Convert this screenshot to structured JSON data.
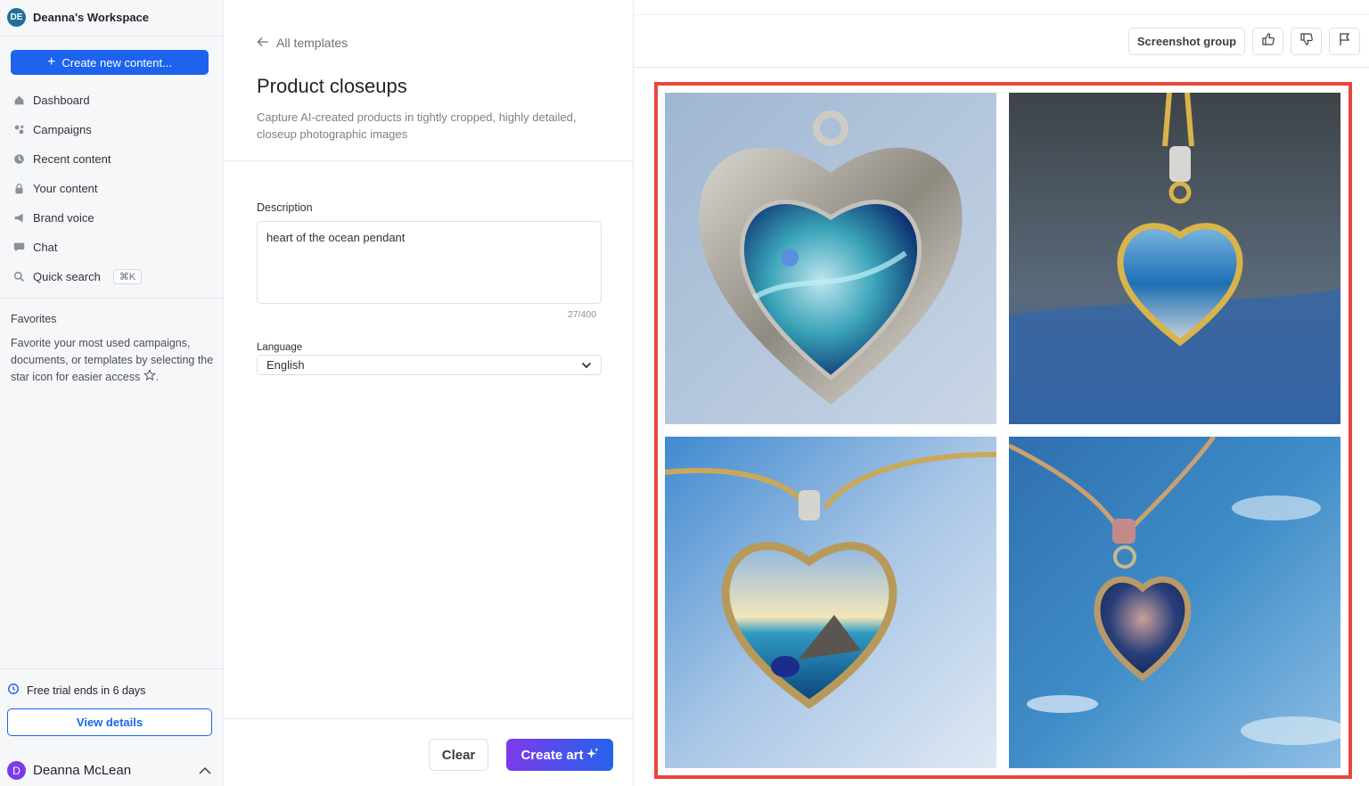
{
  "workspace": {
    "badge": "DE",
    "name": "Deanna's Workspace"
  },
  "create_button": {
    "label": "Create new content..."
  },
  "nav": [
    {
      "label": "Dashboard",
      "icon": "home-icon"
    },
    {
      "label": "Campaigns",
      "icon": "campaigns-icon"
    },
    {
      "label": "Recent content",
      "icon": "clock-icon"
    },
    {
      "label": "Your content",
      "icon": "lock-icon"
    },
    {
      "label": "Brand voice",
      "icon": "megaphone-icon"
    },
    {
      "label": "Chat",
      "icon": "chat-icon"
    },
    {
      "label": "Quick search",
      "icon": "search-icon",
      "shortcut": "⌘K"
    }
  ],
  "favorites": {
    "title": "Favorites",
    "text": "Favorite your most used campaigns, documents, or templates by selecting the star icon for easier access"
  },
  "trial": {
    "text": "Free trial ends in 6 days",
    "button": "View details"
  },
  "user": {
    "initial": "D",
    "name": "Deanna McLean"
  },
  "template": {
    "back_label": "All templates",
    "title": "Product closeups",
    "description": "Capture AI-created products in tightly cropped, highly detailed, closeup photographic images"
  },
  "form": {
    "description_label": "Description",
    "description_value": "heart of the ocean pendant",
    "counter": "27/400",
    "language_label": "Language",
    "language_value": "English",
    "clear_label": "Clear",
    "create_label": "Create art"
  },
  "toolbar": {
    "screenshot_group": "Screenshot group",
    "icons": [
      "thumbs-up-icon",
      "thumbs-down-icon",
      "flag-icon"
    ]
  },
  "colors": {
    "primary": "#1d63ed",
    "highlight_border": "#e8473c",
    "create_art_gradient": [
      "#7c3aed",
      "#2563eb"
    ]
  },
  "images": [
    {
      "alt": "heart pendant closeup 1"
    },
    {
      "alt": "heart pendant closeup 2"
    },
    {
      "alt": "heart pendant closeup 3"
    },
    {
      "alt": "heart pendant closeup 4"
    }
  ]
}
